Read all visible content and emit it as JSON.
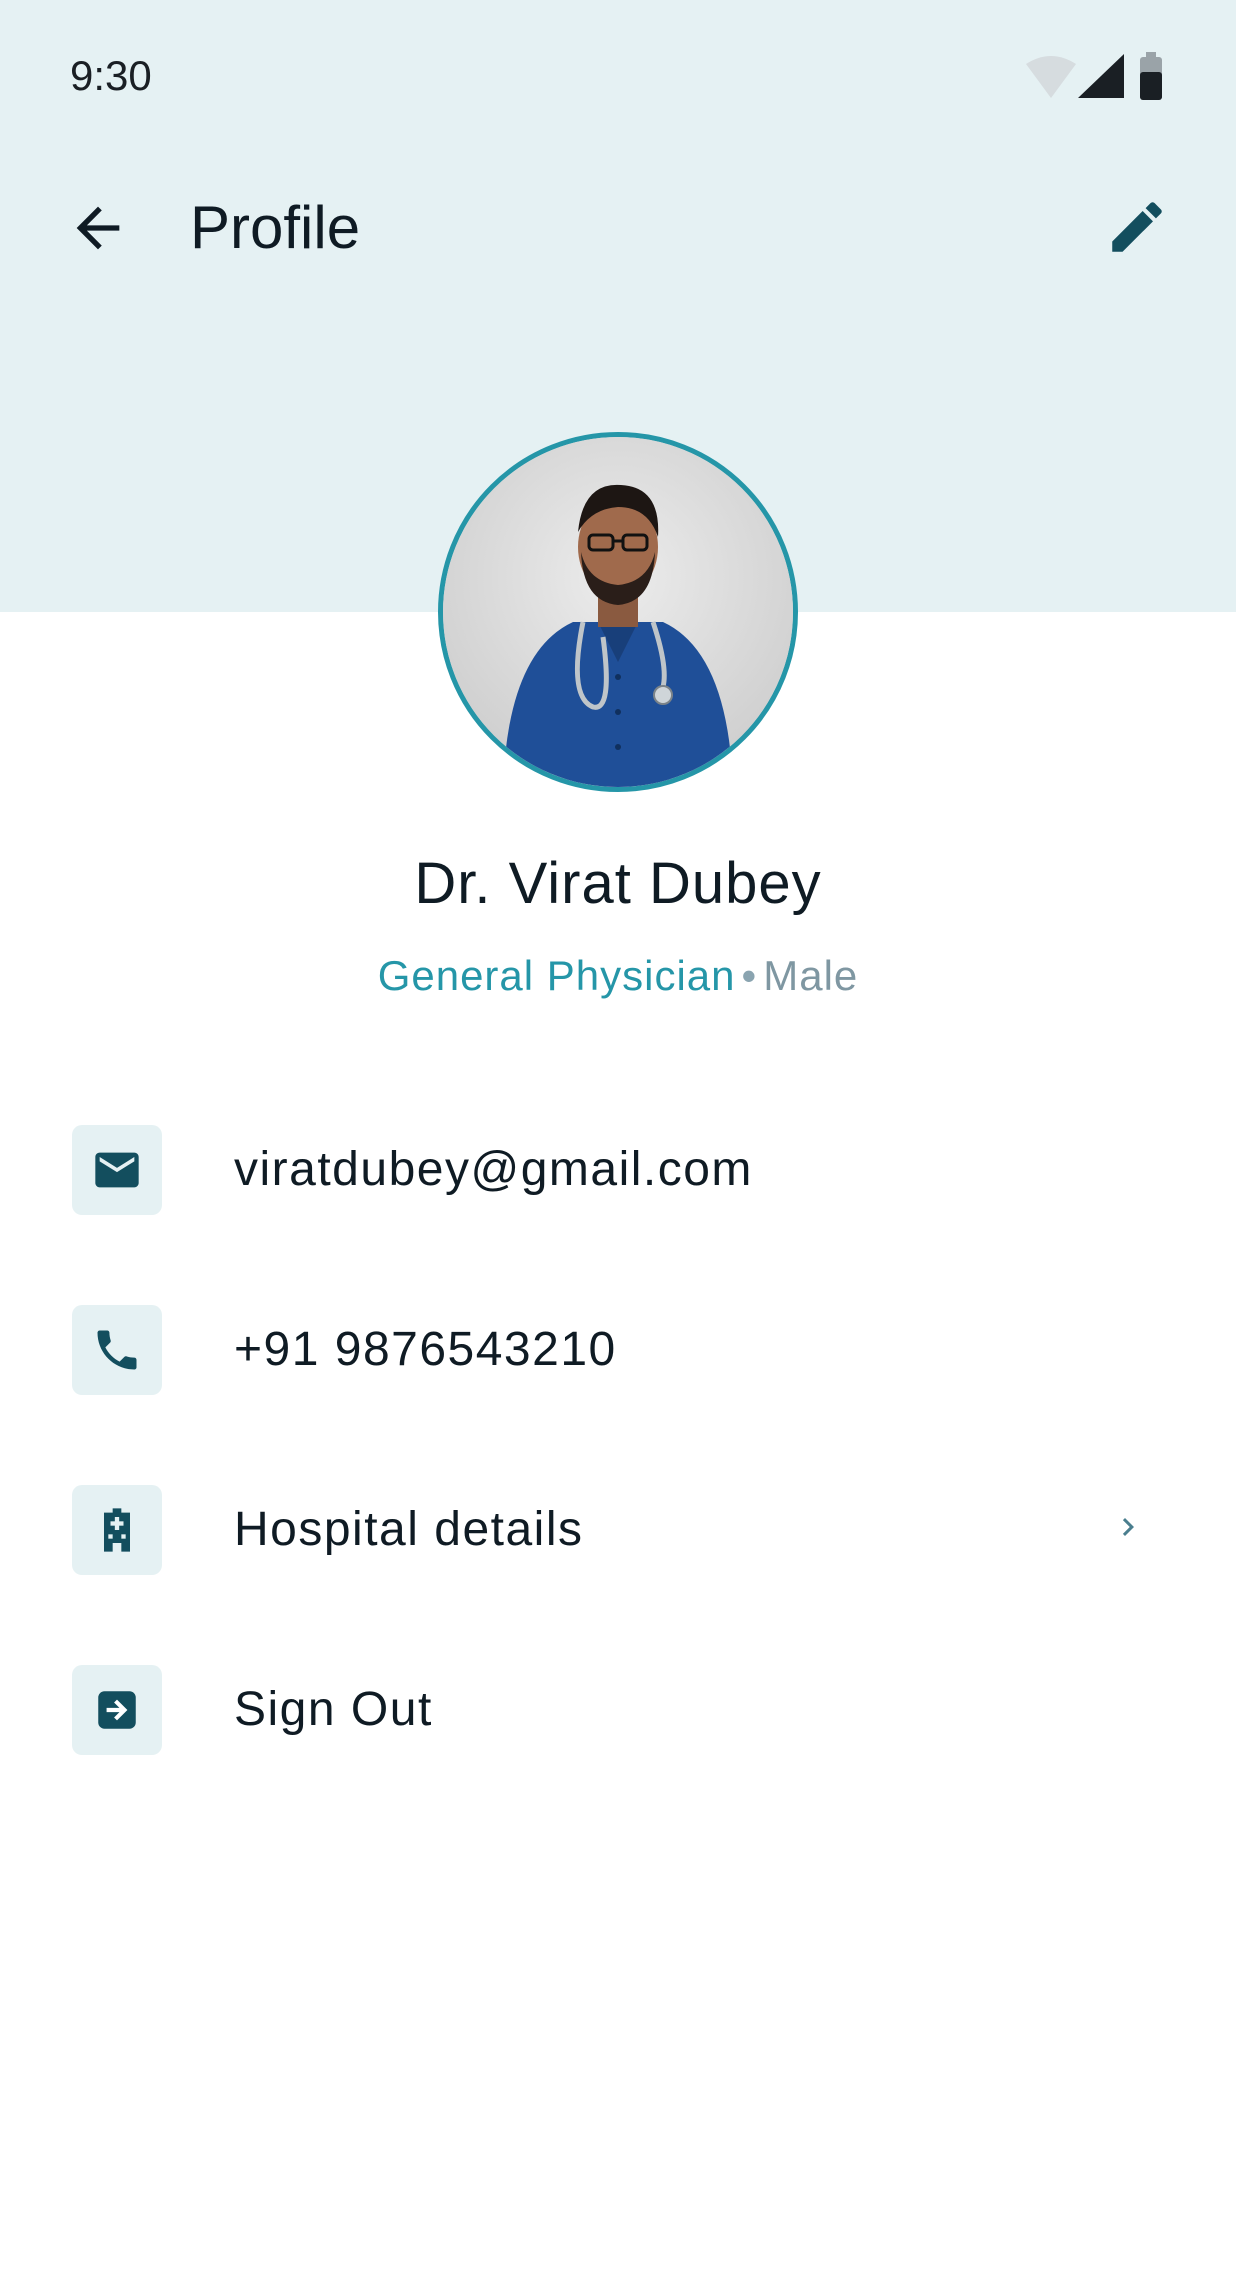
{
  "status_bar": {
    "time": "9:30"
  },
  "app_bar": {
    "title": "Profile"
  },
  "profile": {
    "name": "Dr. Virat Dubey",
    "specialty": "General Physician",
    "separator": "•",
    "gender": "Male"
  },
  "rows": [
    {
      "icon": "email-icon",
      "label": "viratdubey@gmail.com"
    },
    {
      "icon": "phone-icon",
      "label": "+91 9876543210"
    },
    {
      "icon": "hospital-icon",
      "label": "Hospital details",
      "has_chevron": true
    },
    {
      "icon": "sign-out-icon",
      "label": "Sign Out"
    }
  ],
  "colors": {
    "header_bg": "#e5f1f3",
    "accent": "#2596a8",
    "icon_dark": "#134e5e",
    "text": "#0f1b24",
    "muted": "#7f97a2"
  }
}
